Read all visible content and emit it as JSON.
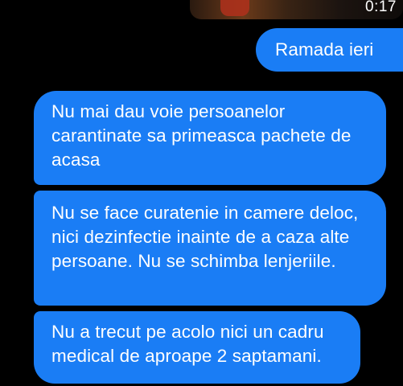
{
  "video": {
    "duration": "0:17"
  },
  "messages": [
    {
      "direction": "outgoing",
      "text": "Ramada ieri"
    },
    {
      "direction": "incoming",
      "text": "Nu mai dau voie persoanelor carantinate sa primeasca pachete de acasa"
    },
    {
      "direction": "incoming",
      "text": "Nu se face curatenie in camere deloc, nici dezinfectie inainte de a caza alte persoane. Nu se schimba lenjeriile."
    },
    {
      "direction": "incoming",
      "text": "Nu a trecut pe acolo nici un cadru medical de aproape 2 saptamani."
    }
  ],
  "colors": {
    "background": "#000000",
    "bubble": "#1a7df5",
    "text": "#ffffff"
  }
}
